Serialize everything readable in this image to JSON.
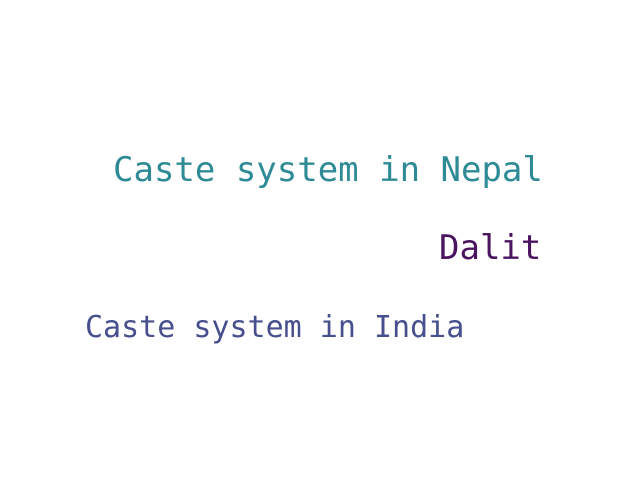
{
  "words": [
    {
      "text": "Caste system in Nepal",
      "color": "#2e8b96"
    },
    {
      "text": "Dalit",
      "color": "#4b1460"
    },
    {
      "text": "Caste system in India",
      "color": "#484f8e"
    }
  ]
}
